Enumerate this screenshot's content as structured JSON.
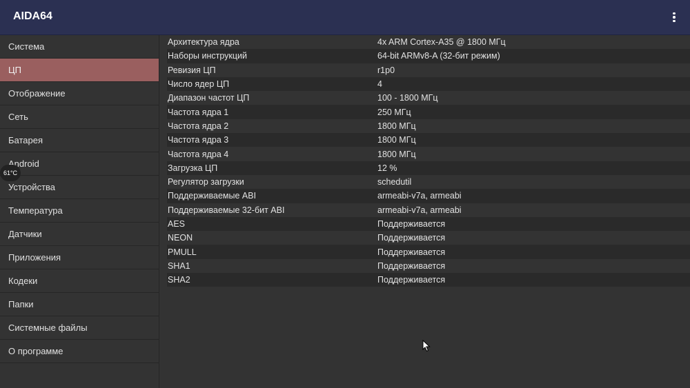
{
  "app": {
    "title": "AIDA64",
    "menu_icon": "more-vert-icon"
  },
  "temperature_badge": "61°C",
  "sidebar": {
    "active_index": 1,
    "items": [
      {
        "label": "Система"
      },
      {
        "label": "ЦП"
      },
      {
        "label": "Отображение"
      },
      {
        "label": "Сеть"
      },
      {
        "label": "Батарея"
      },
      {
        "label": "Android"
      },
      {
        "label": "Устройства"
      },
      {
        "label": "Температура"
      },
      {
        "label": "Датчики"
      },
      {
        "label": "Приложения"
      },
      {
        "label": "Кодеки"
      },
      {
        "label": "Папки"
      },
      {
        "label": "Системные файлы"
      },
      {
        "label": "О программе"
      }
    ]
  },
  "rows": [
    {
      "k": "Архитектура ядра",
      "v": "4x ARM Cortex-A35 @ 1800 МГц"
    },
    {
      "k": "Наборы инструкций",
      "v": "64-bit ARMv8-A (32-бит режим)"
    },
    {
      "k": "Ревизия ЦП",
      "v": "r1p0"
    },
    {
      "k": "Число ядер ЦП",
      "v": "4"
    },
    {
      "k": "Диапазон частот ЦП",
      "v": "100 - 1800 МГц"
    },
    {
      "k": "Частота ядра 1",
      "v": "250 МГц"
    },
    {
      "k": "Частота ядра 2",
      "v": "1800 МГц"
    },
    {
      "k": "Частота ядра 3",
      "v": "1800 МГц"
    },
    {
      "k": "Частота ядра 4",
      "v": "1800 МГц"
    },
    {
      "k": "Загрузка ЦП",
      "v": "12 %"
    },
    {
      "k": "Регулятор загрузки",
      "v": "schedutil"
    },
    {
      "k": "Поддерживаемые ABI",
      "v": "armeabi-v7a, armeabi"
    },
    {
      "k": "Поддерживаемые 32-бит ABI",
      "v": "armeabi-v7a, armeabi"
    },
    {
      "k": "AES",
      "v": "Поддерживается"
    },
    {
      "k": "NEON",
      "v": "Поддерживается"
    },
    {
      "k": "PMULL",
      "v": "Поддерживается"
    },
    {
      "k": "SHA1",
      "v": "Поддерживается"
    },
    {
      "k": "SHA2",
      "v": "Поддерживается"
    }
  ],
  "colors": {
    "header": "#2b3052",
    "active": "#9a5f5f",
    "background": "#333333"
  }
}
